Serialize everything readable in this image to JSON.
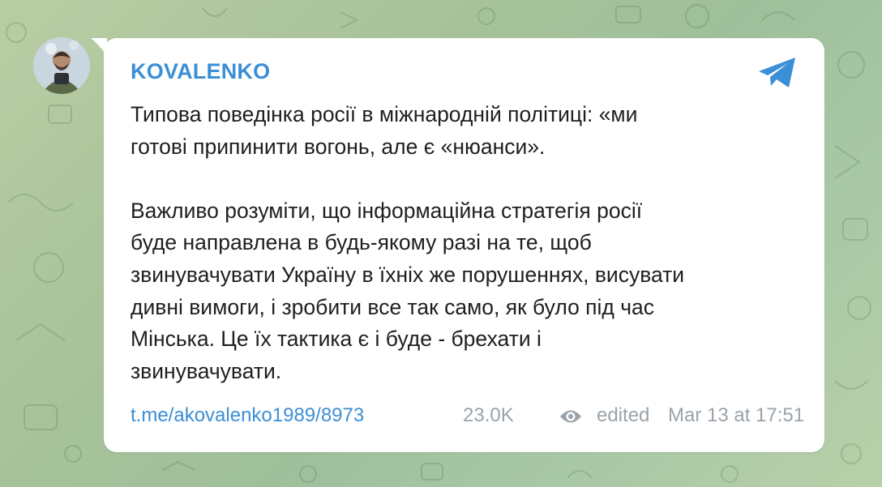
{
  "channel": {
    "name": "KOVALENKO"
  },
  "message": {
    "text": "Типова поведінка росії в міжнародній політиці: «ми\nготові припинити вогонь, але є «нюанси».\n\nВажливо розуміти, що інформаційна стратегія росії\nбуде направлена в будь-якому разі на те, щоб\nзвинувачувати Україну в їхніх же порушеннях, висувати\nдивні вимоги, і зробити все так само, як було під час\nМінська. Це їх тактика є і буде - брехати і\nзвинувачувати."
  },
  "footer": {
    "link": "t.me/akovalenko1989/8973",
    "views": "23.0K",
    "edited_label": "edited",
    "timestamp": "Mar 13 at 17:51"
  },
  "icons": {
    "share": "telegram-plane-icon",
    "views": "eye-icon"
  },
  "colors": {
    "accent": "#3a8fd6",
    "text": "#1f1f1f",
    "meta": "#9aa3ab",
    "bubble": "#ffffff"
  }
}
